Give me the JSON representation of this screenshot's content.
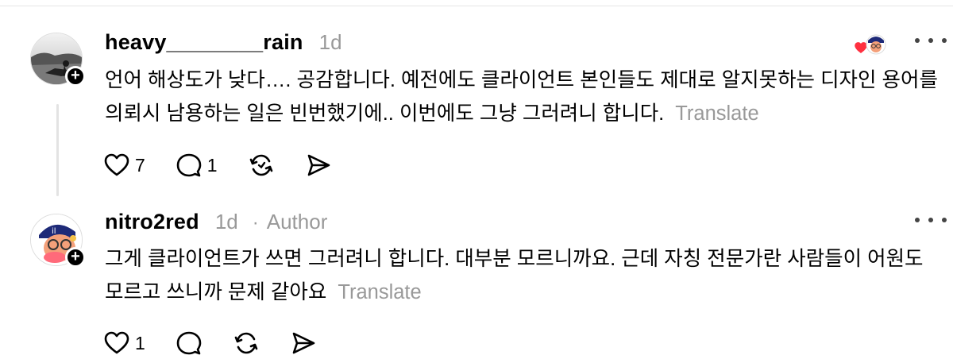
{
  "comments": [
    {
      "username": "heavy________rain",
      "time": "1d",
      "text": "언어 해상도가 낮다…. 공감합니다. 예전에도 클라이언트 본인들도 제대로 알지못하는 디자인 용어를 의뢰시 남용하는 일은 빈번했기에.. 이번에도 그냥 그러려니 합니다.",
      "translate": "Translate",
      "likes": "7",
      "replies": "1"
    },
    {
      "username": "nitro2red",
      "time": "1d",
      "separator": "·",
      "badge": "Author",
      "text": "그게 클라이언트가 쓰면 그러려니 합니다. 대부분 모르니까요. 근데 자칭 전문가란 사람들이 어원도 모르고 쓰니까 문제 같아요",
      "translate": "Translate",
      "likes": "1"
    }
  ],
  "icons": {
    "like": "heart-icon",
    "reply": "speech-bubble-icon",
    "repost": "repost-icon",
    "share": "send-icon",
    "more": "more-dots-icon",
    "follow": "plus-icon"
  },
  "colors": {
    "text": "#000000",
    "muted": "#999999",
    "heart": "#ff3040"
  }
}
